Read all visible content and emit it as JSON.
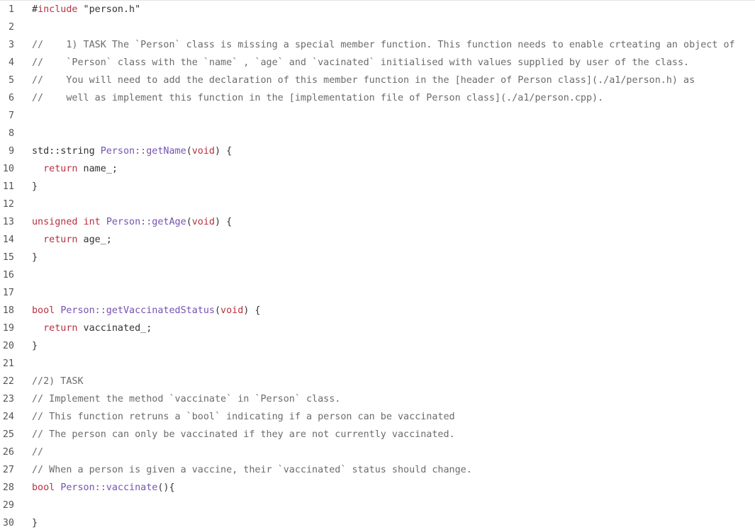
{
  "editor": {
    "colors": {
      "keyword": "#b8303f",
      "function": "#7652b0",
      "comment": "#6b6b6b",
      "text": "#333333",
      "line_number": "#555555"
    },
    "lines": [
      {
        "n": "1",
        "tokens": [
          {
            "t": "#",
            "c": "plain"
          },
          {
            "t": "include",
            "c": "kw"
          },
          {
            "t": " \"person.h\"",
            "c": "str"
          }
        ]
      },
      {
        "n": "2",
        "tokens": []
      },
      {
        "n": "3",
        "tokens": [
          {
            "t": "//    1) TASK The `Person` class is missing a special member function. This function needs to enable crteating an object of",
            "c": "cm"
          }
        ]
      },
      {
        "n": "4",
        "tokens": [
          {
            "t": "//    `Person` class with the `name` , `age` and `vacinated` initialised with values supplied by user of the class.",
            "c": "cm"
          }
        ]
      },
      {
        "n": "5",
        "tokens": [
          {
            "t": "//    You will need to add the declaration of this member function in the [header of Person class](./a1/person.h) as",
            "c": "cm"
          }
        ]
      },
      {
        "n": "6",
        "tokens": [
          {
            "t": "//    well as implement this function in the [implementation file of Person class](./a1/person.cpp).",
            "c": "cm"
          }
        ]
      },
      {
        "n": "7",
        "tokens": []
      },
      {
        "n": "8",
        "tokens": []
      },
      {
        "n": "9",
        "tokens": [
          {
            "t": "std::string ",
            "c": "plain"
          },
          {
            "t": "Person::getName",
            "c": "fn"
          },
          {
            "t": "(",
            "c": "plain"
          },
          {
            "t": "void",
            "c": "kw"
          },
          {
            "t": ") {",
            "c": "plain"
          }
        ]
      },
      {
        "n": "10",
        "tokens": [
          {
            "t": "  ",
            "c": "plain"
          },
          {
            "t": "return",
            "c": "kw"
          },
          {
            "t": " name_;",
            "c": "plain"
          }
        ]
      },
      {
        "n": "11",
        "tokens": [
          {
            "t": "}",
            "c": "plain"
          }
        ]
      },
      {
        "n": "12",
        "tokens": []
      },
      {
        "n": "13",
        "tokens": [
          {
            "t": "unsigned",
            "c": "kw"
          },
          {
            "t": " ",
            "c": "plain"
          },
          {
            "t": "int",
            "c": "kw"
          },
          {
            "t": " ",
            "c": "plain"
          },
          {
            "t": "Person::getAge",
            "c": "fn"
          },
          {
            "t": "(",
            "c": "plain"
          },
          {
            "t": "void",
            "c": "kw"
          },
          {
            "t": ") {",
            "c": "plain"
          }
        ]
      },
      {
        "n": "14",
        "tokens": [
          {
            "t": "  ",
            "c": "plain"
          },
          {
            "t": "return",
            "c": "kw"
          },
          {
            "t": " age_;",
            "c": "plain"
          }
        ]
      },
      {
        "n": "15",
        "tokens": [
          {
            "t": "}",
            "c": "plain"
          }
        ]
      },
      {
        "n": "16",
        "tokens": []
      },
      {
        "n": "17",
        "tokens": []
      },
      {
        "n": "18",
        "tokens": [
          {
            "t": "bool",
            "c": "kw"
          },
          {
            "t": " ",
            "c": "plain"
          },
          {
            "t": "Person::getVaccinatedStatus",
            "c": "fn"
          },
          {
            "t": "(",
            "c": "plain"
          },
          {
            "t": "void",
            "c": "kw"
          },
          {
            "t": ") {",
            "c": "plain"
          }
        ]
      },
      {
        "n": "19",
        "tokens": [
          {
            "t": "  ",
            "c": "plain"
          },
          {
            "t": "return",
            "c": "kw"
          },
          {
            "t": " vaccinated_;",
            "c": "plain"
          }
        ]
      },
      {
        "n": "20",
        "tokens": [
          {
            "t": "}",
            "c": "plain"
          }
        ]
      },
      {
        "n": "21",
        "tokens": []
      },
      {
        "n": "22",
        "tokens": [
          {
            "t": "//2) TASK",
            "c": "cm"
          }
        ]
      },
      {
        "n": "23",
        "tokens": [
          {
            "t": "// Implement the method `vaccinate` in `Person` class.",
            "c": "cm"
          }
        ]
      },
      {
        "n": "24",
        "tokens": [
          {
            "t": "// This function retruns a `bool` indicating if a person can be vaccinated",
            "c": "cm"
          }
        ]
      },
      {
        "n": "25",
        "tokens": [
          {
            "t": "// The person can only be vaccinated if they are not currently vaccinated.",
            "c": "cm"
          }
        ]
      },
      {
        "n": "26",
        "tokens": [
          {
            "t": "//",
            "c": "cm"
          }
        ]
      },
      {
        "n": "27",
        "tokens": [
          {
            "t": "// When a person is given a vaccine, their `vaccinated` status should change.",
            "c": "cm"
          }
        ]
      },
      {
        "n": "28",
        "tokens": [
          {
            "t": "bool",
            "c": "kw"
          },
          {
            "t": " ",
            "c": "plain"
          },
          {
            "t": "Person::vaccinate",
            "c": "fn"
          },
          {
            "t": "(){",
            "c": "plain"
          }
        ]
      },
      {
        "n": "29",
        "tokens": []
      },
      {
        "n": "30",
        "tokens": [
          {
            "t": "}",
            "c": "plain"
          }
        ]
      }
    ]
  }
}
